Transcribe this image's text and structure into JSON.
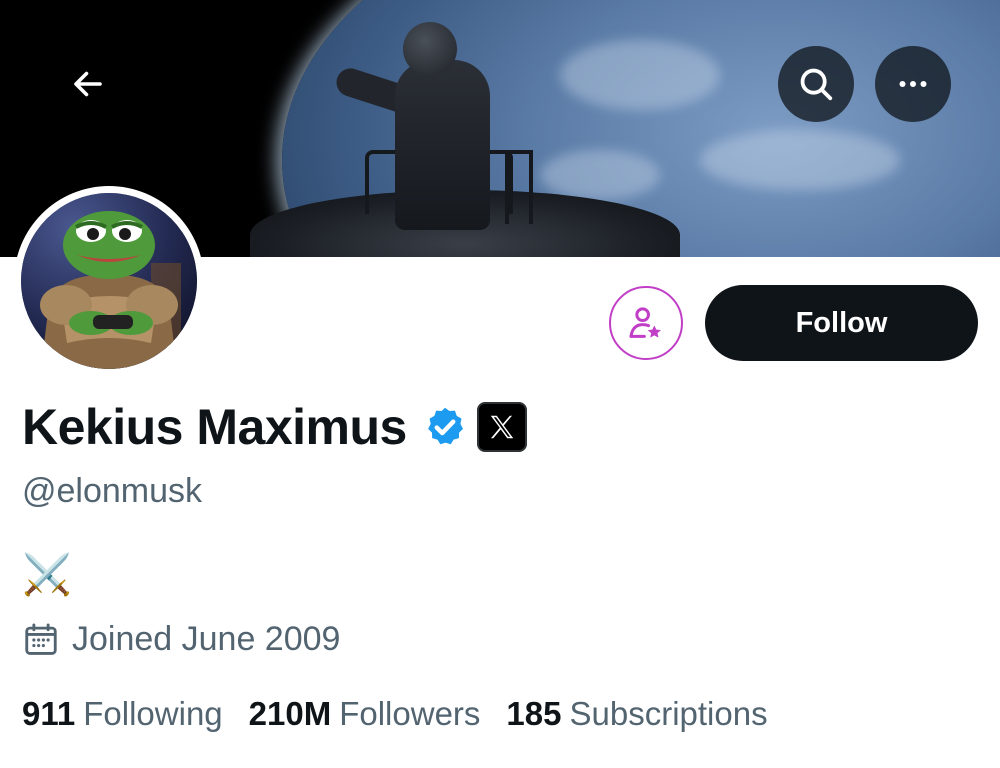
{
  "profile": {
    "display_name": "Kekius Maximus",
    "handle": "@elonmusk",
    "bio_emoji": "⚔️",
    "joined": "Joined June 2009",
    "verified_icon": "verified-badge-icon",
    "affiliate_badge": "x-logo-icon"
  },
  "actions": {
    "follow_label": "Follow",
    "subscribe_icon": "person-star-icon"
  },
  "header": {
    "back_icon": "back-arrow-icon",
    "search_icon": "search-icon",
    "more_icon": "more-horizontal-icon"
  },
  "stats": [
    {
      "value": "911",
      "label": "Following"
    },
    {
      "value": "210M",
      "label": "Followers"
    },
    {
      "value": "185",
      "label": "Subscriptions"
    }
  ],
  "colors": {
    "verified_blue": "#1d9bf0",
    "subscribe_purple": "#c13fc7",
    "text_primary": "#0f1419",
    "text_secondary": "#536471"
  }
}
